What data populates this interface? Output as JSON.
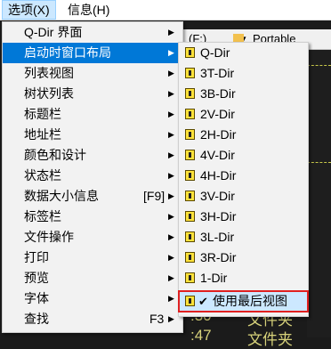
{
  "menubar": {
    "options_label": "选项(X)",
    "info_label": "信息(H)"
  },
  "background": {
    "drive_text": "(F:)",
    "folder_text": "Portable",
    "row1_time": ":30",
    "row1_type": "文件夹",
    "row2_time": ":47",
    "row2_type": "文件夹"
  },
  "menu": {
    "items": [
      {
        "label": "Q-Dir 界面",
        "arrow": "▶"
      },
      {
        "label": "启动时窗口布局",
        "arrow": "▶"
      },
      {
        "label": "列表视图",
        "arrow": "▶"
      },
      {
        "label": "树状列表",
        "arrow": "▶"
      },
      {
        "label": "标题栏",
        "arrow": "▶"
      },
      {
        "label": "地址栏",
        "arrow": "▶"
      },
      {
        "label": "颜色和设计",
        "arrow": "▶"
      },
      {
        "label": "状态栏",
        "arrow": "▶"
      },
      {
        "label": "数据大小信息",
        "shortcut": "[F9]",
        "arrow": "▶"
      },
      {
        "label": "标签栏",
        "arrow": "▶"
      },
      {
        "label": "文件操作",
        "arrow": "▶"
      },
      {
        "label": "打印",
        "arrow": "▶"
      },
      {
        "label": "预览",
        "arrow": "▶"
      },
      {
        "label": "字体",
        "arrow": "▶"
      },
      {
        "label": "查找",
        "shortcut": "F3",
        "arrow": "▶"
      }
    ]
  },
  "submenu": {
    "items": [
      {
        "label": "Q-Dir"
      },
      {
        "label": "3T-Dir"
      },
      {
        "label": "3B-Dir"
      },
      {
        "label": "2V-Dir"
      },
      {
        "label": "2H-Dir"
      },
      {
        "label": "4V-Dir"
      },
      {
        "label": "4H-Dir"
      },
      {
        "label": "3V-Dir"
      },
      {
        "label": "3H-Dir"
      },
      {
        "label": "3L-Dir"
      },
      {
        "label": "3R-Dir"
      },
      {
        "label": "1-Dir"
      },
      {
        "label": "使用最后视图",
        "check": "✔"
      }
    ]
  }
}
